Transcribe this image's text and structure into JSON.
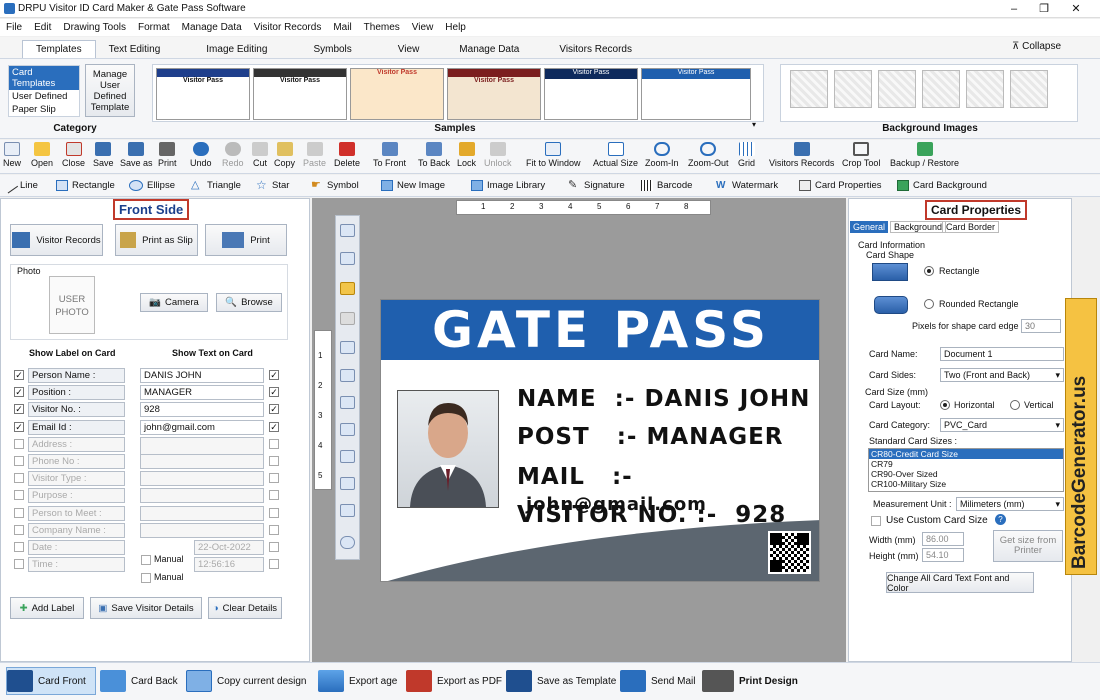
{
  "window": {
    "title": "DRPU Visitor ID Card Maker & Gate Pass Software"
  },
  "menu": [
    "File",
    "Edit",
    "Drawing Tools",
    "Format",
    "Manage Data",
    "Visitor Records",
    "Mail",
    "Themes",
    "View",
    "Help"
  ],
  "ribbon_tabs": [
    "Templates",
    "Text Editing",
    "Image Editing",
    "Symbols",
    "View",
    "Manage Data",
    "Visitors Records"
  ],
  "collapse_label": "Collapse",
  "category": {
    "items": [
      "Card Templates",
      "User Defined",
      "Paper Slip"
    ],
    "manage": "Manage User Defined Template",
    "label": "Category"
  },
  "samples": {
    "label": "Samples",
    "thumbs": [
      "Visitor Pass",
      "Visitor Pass",
      "Visitor Pass",
      "Visitor Pass",
      "Visitor Pass",
      "Visitor Pass"
    ]
  },
  "background_label": "Background Images",
  "toolbar": [
    "New",
    "Open",
    "Close",
    "Save",
    "Save as",
    "Print",
    "Undo",
    "Redo",
    "Cut",
    "Copy",
    "Paste",
    "Delete",
    "To Front",
    "To Back",
    "Lock",
    "Unlock",
    "Fit to Window",
    "Actual Size",
    "Zoom-In",
    "Zoom-Out",
    "Grid",
    "Visitors Records",
    "Crop Tool",
    "Backup / Restore"
  ],
  "drawtools": [
    "Line",
    "Rectangle",
    "Ellipse",
    "Triangle",
    "Star",
    "Symbol",
    "New Image",
    "Image Library",
    "Signature",
    "Barcode",
    "Watermark",
    "Card Properties",
    "Card Background"
  ],
  "left": {
    "title": "Front Side",
    "visitor_records": "Visitor Records",
    "print_slip": "Print as Slip",
    "print": "Print",
    "photo_label": "Photo",
    "photo_placeholder": "USER PHOTO",
    "camera": "Camera",
    "browse": "Browse",
    "show_label": "Show Label on Card",
    "show_text": "Show Text on Card",
    "fields": [
      {
        "label": "Person Name :",
        "value": "DANIS JOHN",
        "on": true
      },
      {
        "label": "Position :",
        "value": "MANAGER",
        "on": true
      },
      {
        "label": "Visitor No. :",
        "value": "928",
        "on": true
      },
      {
        "label": "Email Id :",
        "value": "john@gmail.com",
        "on": true
      },
      {
        "label": "Address :",
        "value": "",
        "on": false
      },
      {
        "label": "Phone No :",
        "value": "",
        "on": false
      },
      {
        "label": "Visitor Type :",
        "value": "",
        "on": false
      },
      {
        "label": "Purpose :",
        "value": "",
        "on": false
      },
      {
        "label": "Person to Meet :",
        "value": "",
        "on": false
      },
      {
        "label": "Company Name :",
        "value": "",
        "on": false
      },
      {
        "label": "Date :",
        "value": "22-Oct-2022",
        "on": false
      },
      {
        "label": "Time :",
        "value": "12:56:16",
        "on": false
      }
    ],
    "manual": "Manual",
    "add_label": "Add Label",
    "save_details": "Save Visitor Details",
    "clear_details": "Clear Details"
  },
  "card": {
    "header": "GATE PASS",
    "header_color": "#1f5fae",
    "name_label": "NAME",
    "name_sep": ":-",
    "name": "DANIS JOHN",
    "post_label": "POST",
    "post_sep": ":-",
    "post": "MANAGER",
    "mail_label": "MAIL",
    "mail_sep": ":-",
    "mail": "john@gmail.com",
    "visitor_label": "VISITOR NO.",
    "visitor_sep": ":-",
    "visitor": "928"
  },
  "ruler_top": [
    "1",
    "2",
    "3",
    "4",
    "5",
    "6",
    "7",
    "8"
  ],
  "ruler_left": [
    "1",
    "2",
    "3",
    "4",
    "5"
  ],
  "right": {
    "title": "Card Properties",
    "tabs": [
      "General",
      "Background",
      "Card Border"
    ],
    "card_information": "Card Information",
    "card_shape": "Card Shape",
    "rectangle": "Rectangle",
    "rounded_rectangle": "Rounded Rectangle",
    "pixels_edge": "Pixels for shape card edge :",
    "pixels_value": "30",
    "card_name_label": "Card Name:",
    "card_name": "Document 1",
    "card_sides_label": "Card Sides:",
    "card_sides": "Two (Front and Back)",
    "card_size": "Card Size (mm)",
    "card_layout_label": "Card Layout:",
    "horizontal": "Horizontal",
    "vertical": "Vertical",
    "card_category_label": "Card Category:",
    "card_category": "PVC_Card",
    "standard_sizes": "Standard Card Sizes :",
    "sizes": [
      "CR80-Credit Card Size",
      "CR79",
      "CR90-Over Sized",
      "CR100-Military Size"
    ],
    "measurement_label": "Measurement Unit :",
    "measurement": "Milimeters (mm)",
    "custom_size": "Use Custom Card Size",
    "width_label": "Width  (mm)",
    "width": "86.00",
    "height_label": "Height  (mm)",
    "height": "54.10",
    "get_size": "Get size from Printer",
    "change_all": "Change All Card Text Font and Color"
  },
  "banner": "BarcodeGenerator.us",
  "bottom": [
    "Card Front",
    "Card Back",
    "Copy current design",
    "Export age",
    "Export as PDF",
    "Save as Template",
    "Send Mail",
    "Print Design"
  ]
}
